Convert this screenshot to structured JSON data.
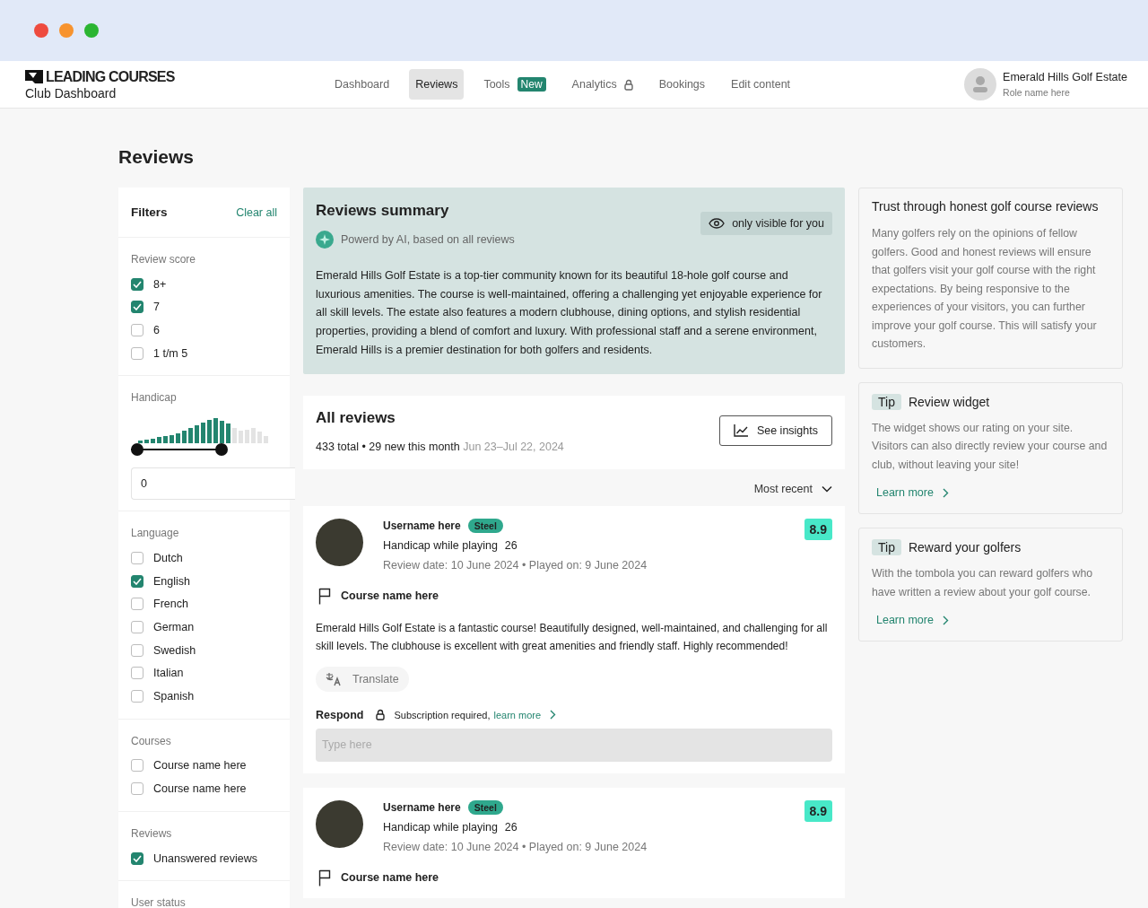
{
  "brand": {
    "logo": "LEADING COURSES",
    "subtitle": "Club Dashboard"
  },
  "nav": [
    {
      "label": "Dashboard",
      "selected": false,
      "locked": false
    },
    {
      "label": "Reviews",
      "selected": true,
      "locked": false
    },
    {
      "label": "Tools",
      "selected": false,
      "locked": false,
      "badge": "New"
    },
    {
      "label": "Analytics",
      "selected": false,
      "locked": true
    },
    {
      "label": "Bookings",
      "selected": false,
      "locked": false
    },
    {
      "label": "Edit content",
      "selected": false,
      "locked": false
    }
  ],
  "user": {
    "name": "Emerald Hills Golf Estate",
    "role": "Role name here"
  },
  "page_title": "Reviews",
  "filters": {
    "title": "Filters",
    "clear": "Clear all",
    "sections": [
      {
        "kind": "checks",
        "title": "Review score",
        "options": [
          {
            "label": "8+",
            "checked": true
          },
          {
            "label": "7",
            "checked": true
          },
          {
            "label": "6",
            "checked": false
          },
          {
            "label": "1 t/m 5",
            "checked": false
          }
        ]
      },
      {
        "kind": "range",
        "title": "Handicap",
        "thumbs": [
          {
            "level": 0
          },
          {
            "level": 0.64
          }
        ],
        "value": "0"
      },
      {
        "kind": "checks",
        "title": "Language",
        "options": [
          {
            "label": "Dutch",
            "checked": false
          },
          {
            "label": "English",
            "checked": true
          },
          {
            "label": "French",
            "checked": false
          },
          {
            "label": "German",
            "checked": false
          },
          {
            "label": "Swedish",
            "checked": false
          },
          {
            "label": "Italian",
            "checked": false
          },
          {
            "label": "Spanish",
            "checked": false
          }
        ]
      },
      {
        "kind": "checks",
        "title": "Courses",
        "options": [
          {
            "label": "Course name here",
            "checked": false
          },
          {
            "label": "Course name here",
            "checked": false
          }
        ]
      },
      {
        "kind": "checks",
        "title": "Reviews",
        "options": [
          {
            "label": "Unanswered reviews",
            "checked": true
          }
        ]
      },
      {
        "kind": "checks",
        "title": "User status"
      }
    ]
  },
  "summary": {
    "title": "Reviews summary",
    "visibility": "only visible for you",
    "powered": "Powerd by AI, based on all reviews",
    "text": "Emerald Hills Golf Estate is a top-tier community known for its beautiful 18-hole golf course and luxurious amenities. The course is well-maintained, offering a challenging yet enjoyable experience for all skill levels. The estate also features a modern clubhouse, dining options, and stylish residential properties, providing a blend of comfort and luxury. With professional staff and a serene environment, Emerald Hills is a premier destination for both golfers and residents."
  },
  "all_reviews": {
    "title": "All reviews",
    "total": "433 total • 29 new this month",
    "range": "Jun 23–Jul 22, 2024",
    "insights": "See insights"
  },
  "sort": "Most recent",
  "reviews": [
    {
      "username": "Username here",
      "tier": "Steel",
      "handicap_label": "Handicap while playing",
      "handicap": "26",
      "dates": "Review date: 10 June 2024 • Played on: 9 June 2024",
      "score": "8.9",
      "course": "Course name here",
      "text": "Emerald Hills Golf Estate is a fantastic course! Beautifully designed, well-maintained, and challenging for all skill levels. The clubhouse is excellent with great amenities and friendly staff. Highly recommended!",
      "translate": "Translate",
      "respond": "Respond",
      "subscription": "Subscription required,",
      "learn": "learn more",
      "placeholder": "Type here"
    },
    {
      "username": "Username here",
      "tier": "Steel",
      "handicap_label": "Handicap while playing",
      "handicap": "26",
      "dates": "Review date: 10 June 2024 • Played on: 9 June 2024",
      "score": "8.9",
      "course": "Course name here"
    }
  ],
  "tips": [
    {
      "kind": "info",
      "title": "Trust through honest golf course reviews",
      "text": "Many golfers rely on the opinions of fellow golfers. Good and honest reviews will ensure that golfers visit your golf course with the right expectations. By being responsive to the experiences of your visitors, you can further improve your golf course. This will satisfy your customers."
    },
    {
      "kind": "tip",
      "tag": "Tip",
      "title": "Review widget",
      "text": "The widget shows our rating on your site. Visitors can also directly review your course and club, without leaving your site!",
      "link": "Learn more"
    },
    {
      "kind": "tip",
      "tag": "Tip",
      "title": "Reward your golfers",
      "text": "With the tombola you can reward golfers who have written a review about your golf course.",
      "link": "Learn more"
    }
  ]
}
